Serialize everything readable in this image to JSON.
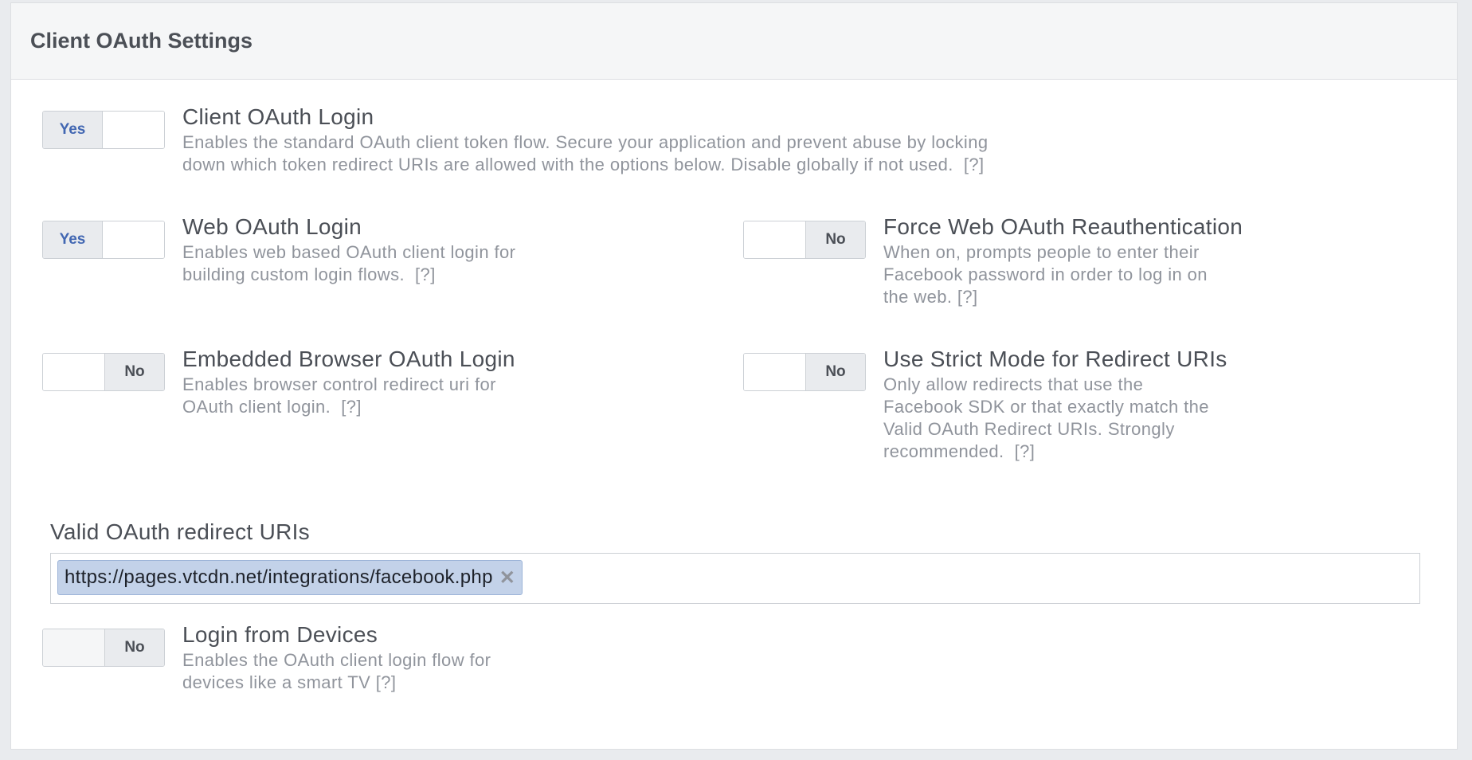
{
  "panel": {
    "title": "Client OAuth Settings"
  },
  "settings": {
    "client_oauth_login": {
      "toggle": "Yes",
      "title": "Client OAuth Login",
      "desc_line1": "Enables the standard OAuth client token flow. Secure your application and prevent abuse by locking",
      "desc_line2": "down which token redirect URIs are allowed with the options below. Disable globally if not used.",
      "help": "[?]"
    },
    "web_oauth_login": {
      "toggle": "Yes",
      "title": "Web OAuth Login",
      "desc_line1": "Enables web based OAuth client login for",
      "desc_line2": "building custom login flows.",
      "help": "[?]"
    },
    "force_web_reauth": {
      "toggle": "No",
      "title": "Force Web OAuth Reauthentication",
      "desc_line1": "When on, prompts people to enter their",
      "desc_line2": "Facebook password in order to log in on",
      "desc_line3": "the web.",
      "help": "[?]"
    },
    "embedded_browser_login": {
      "toggle": "No",
      "title": "Embedded Browser OAuth Login",
      "desc_line1": "Enables browser control redirect uri for",
      "desc_line2": "OAuth client login.",
      "help": "[?]"
    },
    "strict_mode": {
      "toggle": "No",
      "title": "Use Strict Mode for Redirect URIs",
      "desc_line1": "Only allow redirects that use the",
      "desc_line2": "Facebook SDK or that exactly match the",
      "desc_line3": "Valid OAuth Redirect URIs. Strongly",
      "desc_line4": "recommended.",
      "help": "[?]"
    },
    "login_from_devices": {
      "toggle": "No",
      "title": "Login from Devices",
      "desc_line1": "Enables the OAuth client login flow for",
      "desc_line2": "devices like a smart TV",
      "help": "[?]"
    }
  },
  "redirect_uris": {
    "label": "Valid OAuth redirect URIs",
    "tokens": [
      "https://pages.vtcdn.net/integrations/facebook.php"
    ],
    "remove_glyph": "✕"
  },
  "colors": {
    "accent": "#4267b2",
    "token_bg": "#c3d2e9",
    "header_bg": "#f5f6f7"
  }
}
